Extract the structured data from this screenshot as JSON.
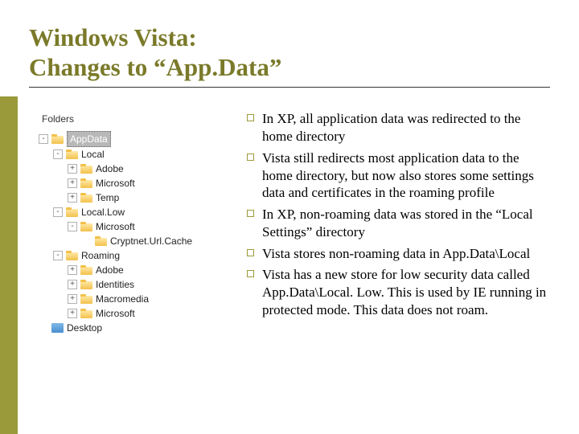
{
  "title_line1": "Windows Vista:",
  "title_line2": "Changes to “App.Data”",
  "tree": {
    "header": "Folders",
    "nodes": [
      {
        "depth": 0,
        "toggle": "-",
        "label": "AppData",
        "selected": true,
        "icon": "folder"
      },
      {
        "depth": 1,
        "toggle": "-",
        "label": "Local",
        "icon": "folder"
      },
      {
        "depth": 2,
        "toggle": "+",
        "label": "Adobe",
        "icon": "folder"
      },
      {
        "depth": 2,
        "toggle": "+",
        "label": "Microsoft",
        "icon": "folder"
      },
      {
        "depth": 2,
        "toggle": "+",
        "label": "Temp",
        "icon": "folder"
      },
      {
        "depth": 1,
        "toggle": "-",
        "label": "Local.Low",
        "icon": "folder"
      },
      {
        "depth": 2,
        "toggle": "-",
        "label": "Microsoft",
        "icon": "folder"
      },
      {
        "depth": 3,
        "toggle": "",
        "label": "Cryptnet.Url.Cache",
        "icon": "folder"
      },
      {
        "depth": 1,
        "toggle": "-",
        "label": "Roaming",
        "icon": "folder"
      },
      {
        "depth": 2,
        "toggle": "+",
        "label": "Adobe",
        "icon": "folder"
      },
      {
        "depth": 2,
        "toggle": "+",
        "label": "Identities",
        "icon": "folder"
      },
      {
        "depth": 2,
        "toggle": "+",
        "label": "Macromedia",
        "icon": "folder"
      },
      {
        "depth": 2,
        "toggle": "+",
        "label": "Microsoft",
        "icon": "folder"
      },
      {
        "depth": 0,
        "toggle": "",
        "label": "Desktop",
        "icon": "desktop"
      }
    ]
  },
  "bullets": [
    "In XP, all application data was redirected to the home directory",
    "Vista still redirects most application data to the home directory, but now also stores some settings data and certificates in the roaming profile",
    "In XP, non-roaming data was stored in the “Local Settings” directory",
    "Vista stores non-roaming data in App.Data\\Local",
    "Vista has a new store for low security data called App.Data\\Local. Low. This is used by IE running in protected mode. This data does not roam."
  ]
}
